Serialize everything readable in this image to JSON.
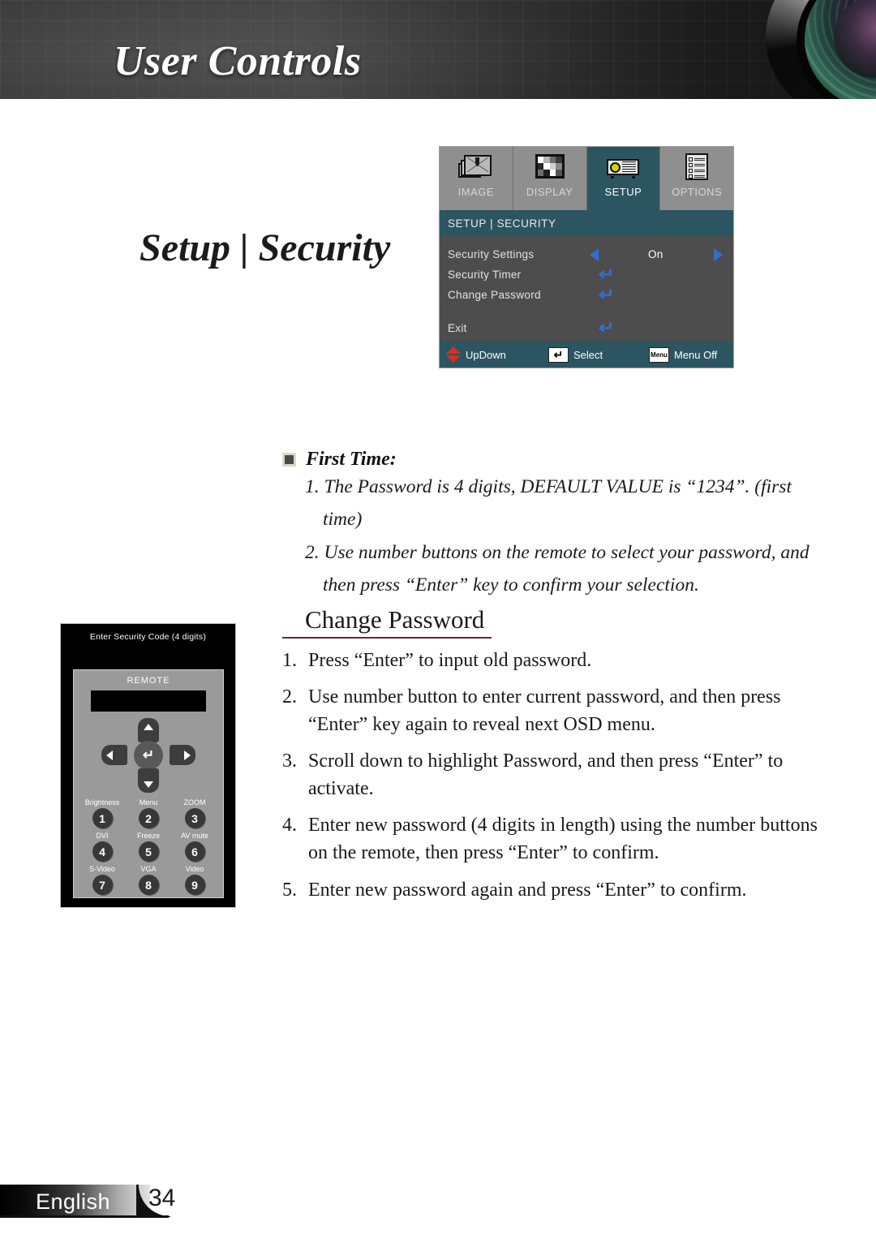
{
  "header": {
    "title": "User Controls",
    "lens_icon": "camera-lens-icon"
  },
  "page_title": "Setup | Security",
  "osd": {
    "tabs": [
      {
        "label": "IMAGE",
        "icon": "image-stack-icon",
        "active": false
      },
      {
        "label": "DISPLAY",
        "icon": "checkerboard-icon",
        "active": false
      },
      {
        "label": "SETUP",
        "icon": "projector-icon",
        "active": true
      },
      {
        "label": "OPTIONS",
        "icon": "checklist-icon",
        "active": false
      }
    ],
    "breadcrumb": "SETUP | SECURITY",
    "rows": [
      {
        "label": "Security Settings",
        "type": "spinner",
        "value": "On"
      },
      {
        "label": "Security Timer",
        "type": "enter",
        "value": ""
      },
      {
        "label": "Change Password",
        "type": "enter",
        "value": ""
      }
    ],
    "exit": {
      "label": "Exit",
      "type": "enter"
    },
    "enter_glyph": "↵",
    "hints": [
      {
        "label": "UpDown",
        "icon": "up-down-arrows-icon"
      },
      {
        "label": "Select",
        "icon": "enter-key-icon",
        "key": "↵"
      },
      {
        "label": "Menu Off",
        "icon": "menu-key-icon",
        "key": "Menu"
      }
    ],
    "colors": {
      "accent_teal": "#2c5562",
      "body_gray": "#4d4d4d",
      "tab_gray": "#8f8f8f",
      "arrow_blue": "#2f6fd0",
      "hint_red": "#e02b20"
    }
  },
  "first_time": {
    "heading": "First Time:",
    "items": [
      "1. The Password is 4 digits, DEFAULT VALUE is “1234”. (first time)",
      "2. Use number buttons on the remote to select your password, and then press “Enter” key to confirm your selection."
    ]
  },
  "change_password": {
    "heading": "Change Password",
    "steps": [
      {
        "num": "1.",
        "text": "Press “Enter” to input old password."
      },
      {
        "num": "2.",
        "text": "Use number button to enter current password, and then press “Enter” key again to reveal next OSD menu."
      },
      {
        "num": "3.",
        "text": "Scroll down to highlight Password, and then press “Enter” to activate."
      },
      {
        "num": "4.",
        "text": "Enter new password (4 digits in length) using the number buttons on the remote, then press “Enter” to confirm."
      },
      {
        "num": "5.",
        "text": "Enter new password again and press “Enter” to confirm."
      }
    ]
  },
  "remote": {
    "caption": "Enter Security Code (4 digits)",
    "title": "REMOTE",
    "enter_glyph": "↵",
    "keypad": [
      [
        {
          "label": "Brightness",
          "digit": "1"
        },
        {
          "label": "Menu",
          "digit": "2"
        },
        {
          "label": "ZOOM",
          "digit": "3"
        }
      ],
      [
        {
          "label": "DVI",
          "digit": "4"
        },
        {
          "label": "Freeze",
          "digit": "5"
        },
        {
          "label": "AV mute",
          "digit": "6"
        }
      ],
      [
        {
          "label": "S-Video",
          "digit": "7"
        },
        {
          "label": "VGA",
          "digit": "8"
        },
        {
          "label": "Video",
          "digit": "9"
        }
      ]
    ]
  },
  "footer": {
    "language": "English",
    "page_number": "34"
  }
}
